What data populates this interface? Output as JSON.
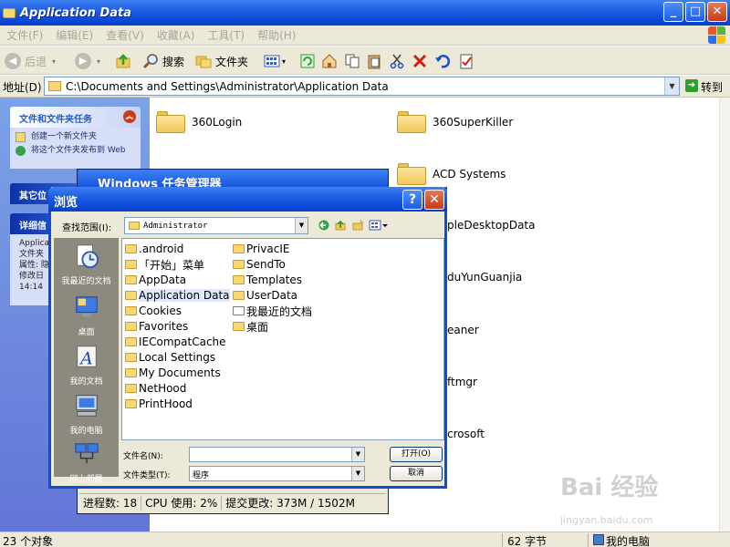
{
  "window": {
    "title": "Application Data",
    "btn_min": "_",
    "btn_max": "□",
    "btn_close": "✕"
  },
  "menu": [
    "文件(F)",
    "编辑(E)",
    "查看(V)",
    "收藏(A)",
    "工具(T)",
    "帮助(H)"
  ],
  "toolbar": {
    "back_label": "后退",
    "search_label": "搜索",
    "folders_label": "文件夹"
  },
  "address": {
    "label": "地址(D)",
    "value": "C:\\Documents and Settings\\Administrator\\Application Data",
    "go_label": "转到"
  },
  "taskpane": {
    "file_tasks_title": "文件和文件夹任务",
    "file_tasks": [
      "创建一个新文件夹",
      "将这个文件夹发布到 Web"
    ],
    "other_title": "其它位",
    "details_title": "详细信",
    "details_lines": [
      "Applica",
      "文件夹",
      "属性: 隐",
      "修改日",
      "14:14"
    ]
  },
  "main_items": [
    "360Login",
    "360SuperKiller",
    "ACD Systems",
    "pleDesktopData",
    "duYunGuanjia",
    "eaner",
    "ftmgr",
    "crosoft"
  ],
  "taskmgr": {
    "title": "Windows 任务管理器",
    "processes": "进程数: 18",
    "cpu": "CPU 使用: 2%",
    "commit": "提交更改: 373M / 1502M"
  },
  "dialog": {
    "title": "浏览",
    "help_btn": "?",
    "close_btn": "✕",
    "lookin_label": "查找范围(I):",
    "lookin_value": "Administrator",
    "places": [
      "我最近的文档",
      "桌面",
      "我的文档",
      "我的电脑",
      "网上邻居"
    ],
    "files_col1": [
      ".android",
      "「开始」菜单",
      "AppData",
      "Application Data",
      "Cookies",
      "Favorites",
      "IECompatCache",
      "Local Settings",
      "My Documents",
      "NetHood",
      "PrintHood"
    ],
    "files_col2": [
      "PrivacIE",
      "SendTo",
      "Templates",
      "UserData",
      "我最近的文档",
      "桌面"
    ],
    "filename_label": "文件名(N):",
    "filename_value": "",
    "filetype_label": "文件类型(T):",
    "filetype_value": "程序",
    "open_btn": "打开(O)",
    "cancel_btn": "取消"
  },
  "status": {
    "objects": "23 个对象",
    "size": "62 字节",
    "location": "我的电脑"
  },
  "watermark": {
    "brand": "Bai 经验",
    "url": "jingyan.baidu.com"
  },
  "colors": {
    "titlebar": "#0a46d6",
    "chrome": "#ece9d8",
    "taskpane": "#6375d6",
    "folder": "#f0c95a"
  }
}
